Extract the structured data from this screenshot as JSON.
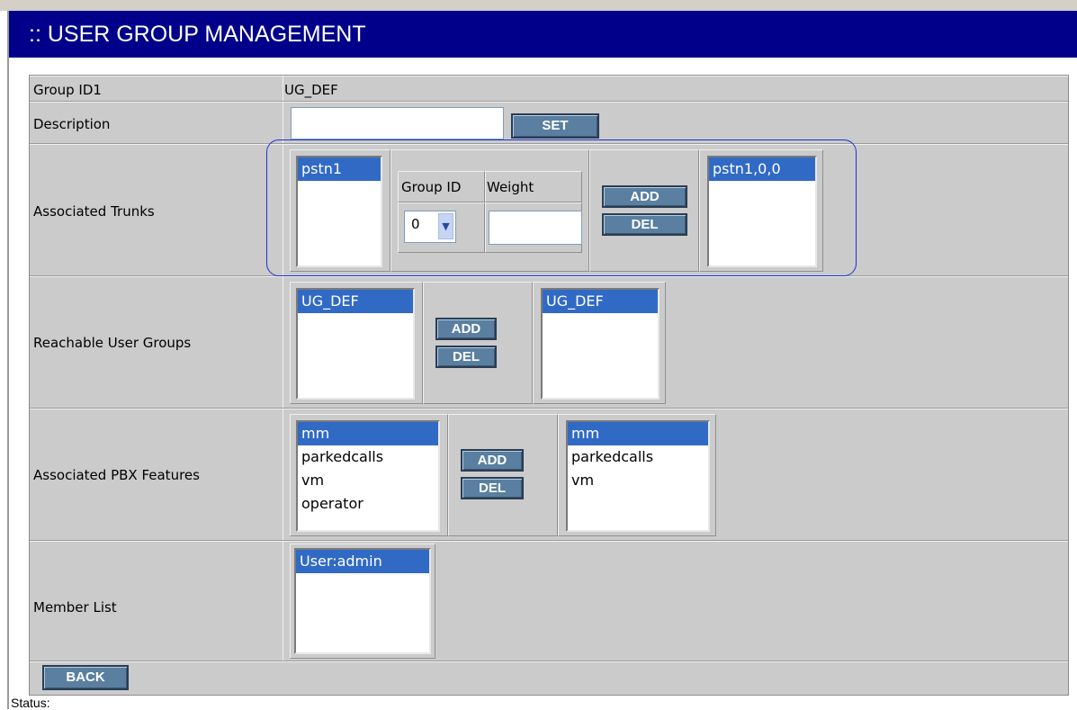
{
  "header": {
    "title": ":: USER GROUP MANAGEMENT"
  },
  "rows": {
    "group_id": {
      "label": "Group ID1",
      "value": "UG_DEF"
    },
    "description": {
      "label": "Description",
      "input_value": "",
      "set_button": "SET"
    },
    "trunks": {
      "label": "Associated Trunks",
      "available": [
        "pstn1"
      ],
      "group_id_header": "Group ID",
      "weight_header": "Weight",
      "group_id_selected": "0",
      "weight_value": "",
      "add_button": "ADD",
      "del_button": "DEL",
      "associated": [
        "pstn1,0,0"
      ]
    },
    "user_groups": {
      "label": "Reachable User Groups",
      "available": [
        "UG_DEF"
      ],
      "add_button": "ADD",
      "del_button": "DEL",
      "selected": [
        "UG_DEF"
      ]
    },
    "pbx_features": {
      "label": "Associated PBX Features",
      "available": [
        "mm",
        "parkedcalls",
        "vm",
        "operator"
      ],
      "add_button": "ADD",
      "del_button": "DEL",
      "selected": [
        "mm",
        "parkedcalls",
        "vm"
      ]
    },
    "members": {
      "label": "Member List",
      "items": [
        "User:admin"
      ]
    }
  },
  "back_button": "BACK",
  "status_label": "Status:"
}
